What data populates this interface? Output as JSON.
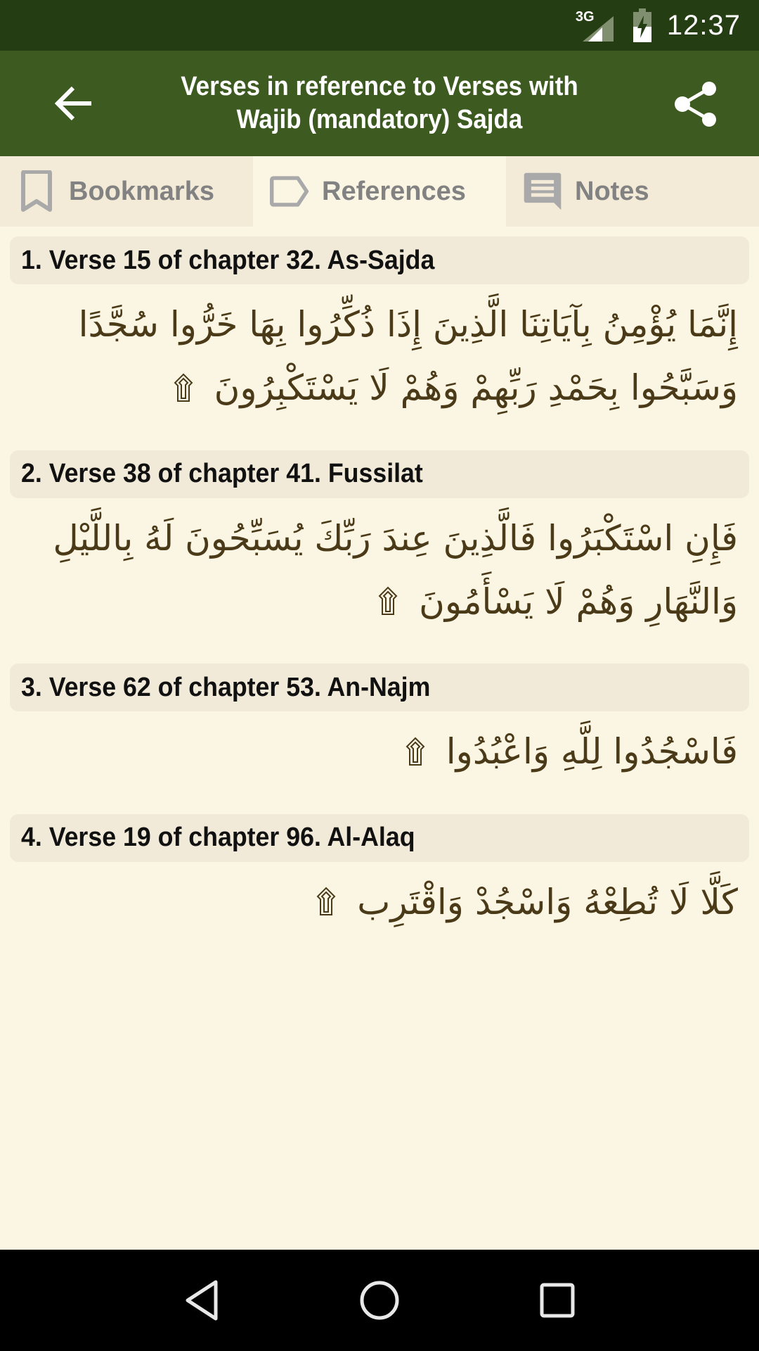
{
  "status_bar": {
    "network": "3G",
    "time": "12:37"
  },
  "app_bar": {
    "title": "Verses in reference to Verses with Wajib (mandatory) Sajda",
    "back_icon": "arrow-back-icon",
    "share_icon": "share-icon"
  },
  "tabs": [
    {
      "label": "Bookmarks",
      "icon": "bookmark-icon",
      "active": false
    },
    {
      "label": "References",
      "icon": "label-tag-icon",
      "active": true
    },
    {
      "label": "Notes",
      "icon": "note-comment-icon",
      "active": false
    }
  ],
  "verses": [
    {
      "header": "1. Verse 15 of chapter 32. As-Sajda",
      "arabic": "إِنَّمَا يُؤْمِنُ بِآيَاتِنَا الَّذِينَ إِذَا ذُكِّرُوا بِهَا خَرُّوا سُجَّدًا وَسَبَّحُوا بِحَمْدِ رَبِّهِمْ وَهُمْ لَا يَسْتَكْبِرُونَ"
    },
    {
      "header": "2. Verse 38 of chapter 41. Fussilat",
      "arabic": "فَإِنِ اسْتَكْبَرُوا فَالَّذِينَ عِندَ رَبِّكَ يُسَبِّحُونَ لَهُ بِاللَّيْلِ وَالنَّهَارِ وَهُمْ لَا يَسْأَمُونَ"
    },
    {
      "header": "3. Verse 62 of chapter 53. An-Najm",
      "arabic": "فَاسْجُدُوا لِلَّهِ وَاعْبُدُوا"
    },
    {
      "header": "4. Verse 19 of chapter 96. Al-Alaq",
      "arabic": "كَلَّا لَا تُطِعْهُ وَاسْجُدْ وَاقْتَرِب"
    }
  ],
  "nav_bar": {
    "back": "nav-back-icon",
    "home": "nav-home-icon",
    "recents": "nav-recents-icon"
  },
  "colors": {
    "status_bar": "#253d12",
    "app_bar": "#3d5b20",
    "background": "#fbf5e3",
    "tab_inactive": "#f3ebd8",
    "header_box": "#f2ead8",
    "arabic_text": "#4a3a18",
    "tab_label": "#828282"
  }
}
